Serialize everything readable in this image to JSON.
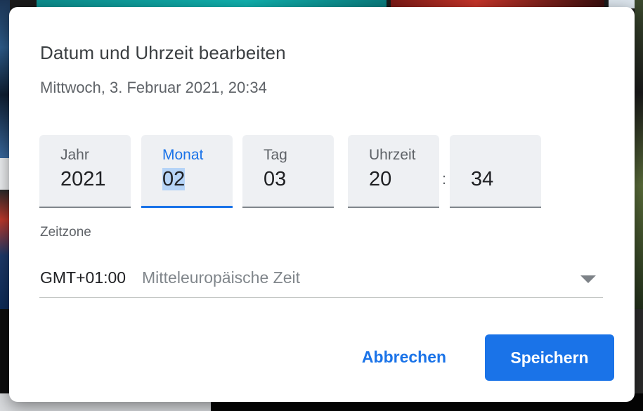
{
  "dialog": {
    "title": "Datum und Uhrzeit bearbeiten",
    "subtitle": "Mittwoch, 3. Februar 2021, 20:34"
  },
  "fields": {
    "year": {
      "label": "Jahr",
      "value": "2021"
    },
    "month": {
      "label": "Monat",
      "value": "02"
    },
    "day": {
      "label": "Tag",
      "value": "03"
    },
    "hour": {
      "label": "Uhrzeit",
      "value": "20"
    },
    "minute": {
      "label": "",
      "value": "34"
    },
    "time_separator": ":"
  },
  "timezone": {
    "label": "Zeitzone",
    "offset": "GMT+01:00",
    "name": "Mitteleuropäische Zeit",
    "icon": "dropdown-arrow-icon"
  },
  "actions": {
    "cancel_label": "Abbrechen",
    "save_label": "Speichern"
  },
  "colors": {
    "accent": "#1a73e8",
    "field_background": "#eef0f3",
    "selection": "#b6d4f7"
  }
}
